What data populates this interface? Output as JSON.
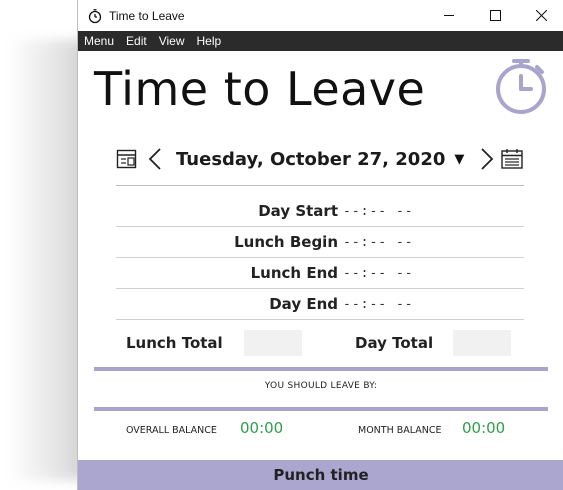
{
  "window": {
    "title": "Time to Leave",
    "minimize_icon": "minimize-icon",
    "maximize_icon": "maximize-icon",
    "close_icon": "close-icon"
  },
  "menubar": {
    "items": [
      "Menu",
      "Edit",
      "View",
      "Help"
    ]
  },
  "header": {
    "title": "Time to Leave",
    "icon": "stopwatch-icon"
  },
  "date_nav": {
    "date": "Tuesday, October 27, 2020",
    "caret": "▼",
    "left_icon": "calendar-switch-icon",
    "prev_icon": "chevron-left-icon",
    "next_icon": "chevron-right-icon",
    "right_icon": "calendar-icon"
  },
  "times": [
    {
      "label": "Day Start",
      "value": "--:-- --"
    },
    {
      "label": "Lunch Begin",
      "value": "--:-- --"
    },
    {
      "label": "Lunch End",
      "value": "--:-- --"
    },
    {
      "label": "Day End",
      "value": "--:-- --"
    }
  ],
  "totals": {
    "lunch_label": "Lunch Total",
    "lunch_value": "",
    "day_label": "Day Total",
    "day_value": ""
  },
  "leave": {
    "label": "YOU SHOULD LEAVE BY:"
  },
  "balance": {
    "overall_label": "OVERALL BALANCE",
    "overall_value": "00:00",
    "month_label": "MONTH BALANCE",
    "month_value": "00:00"
  },
  "punch": {
    "label": "Punch time"
  },
  "colors": {
    "accent": "#a9a4cc",
    "balance_positive": "#2e9e4c",
    "menubar": "#2b2b2b"
  }
}
